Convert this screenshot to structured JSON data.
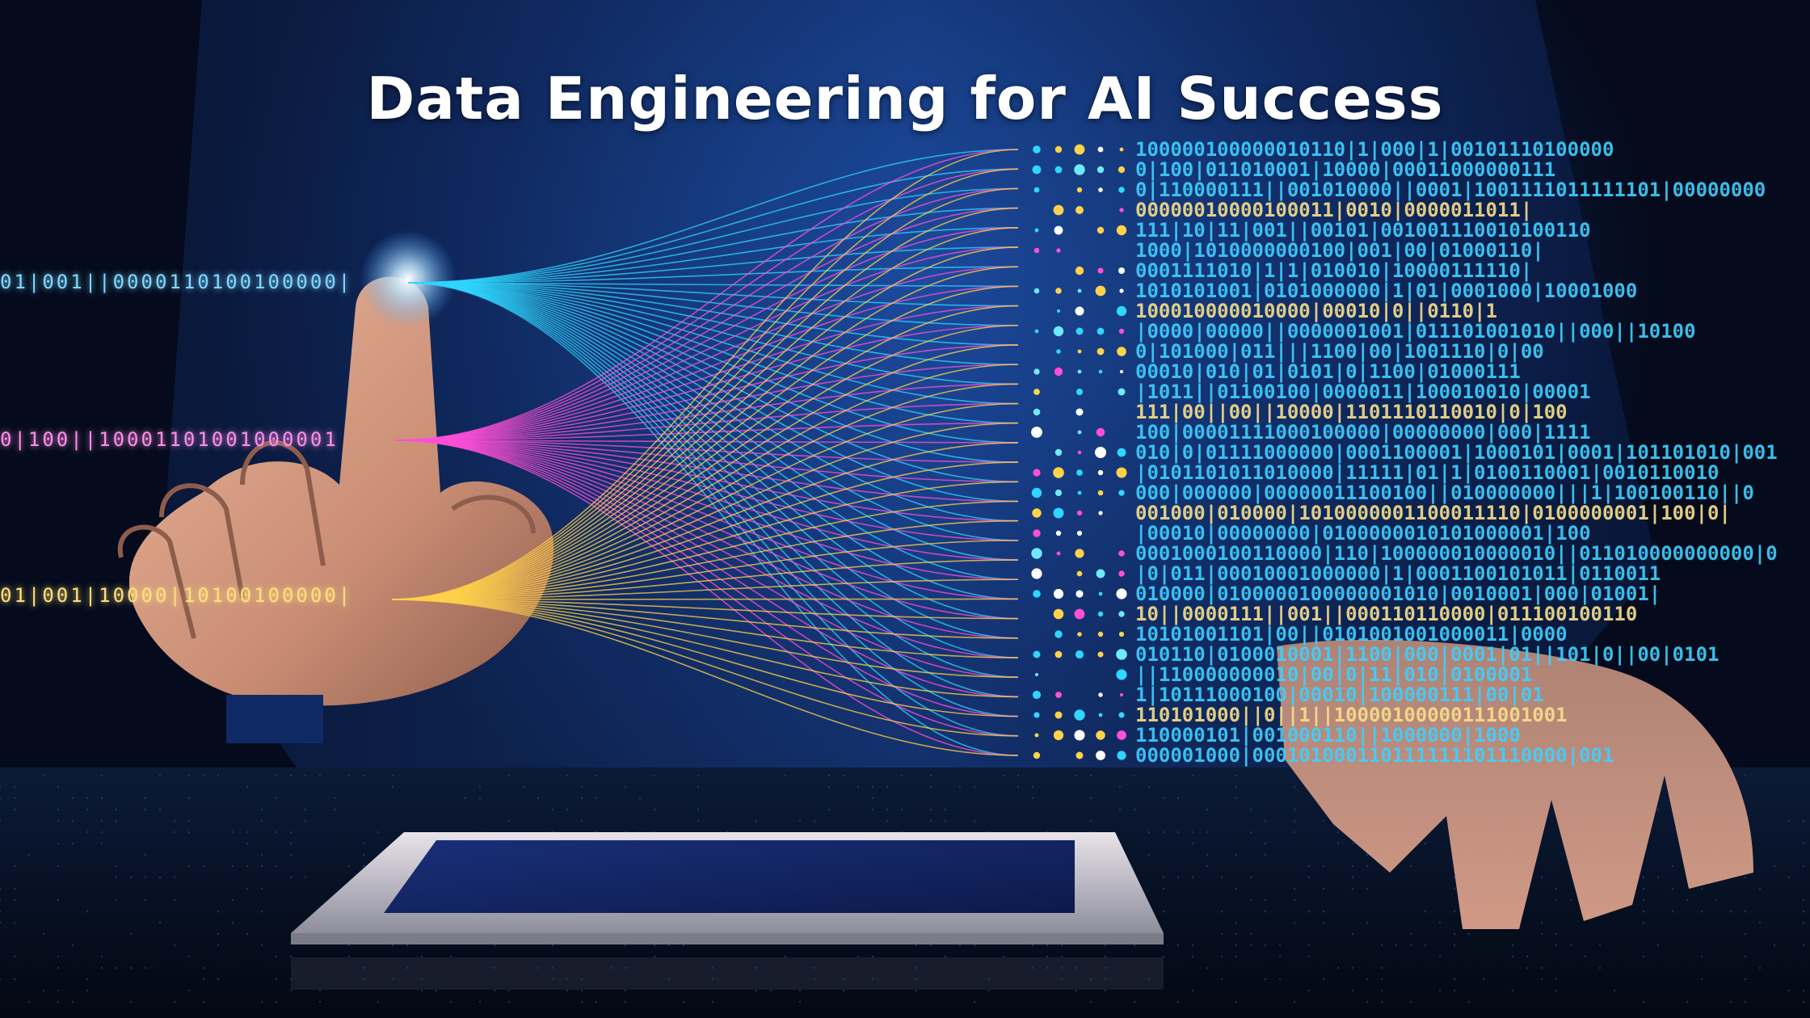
{
  "title": "Data Engineering for AI Success",
  "left_streams": [
    {
      "text": "01|001||0000110100100000|",
      "color": "#7fd8ff"
    },
    {
      "text": "0|100||10001101001000001",
      "color": "#ff8ee8"
    },
    {
      "text": "01|001|10000|10100100000|",
      "color": "#ffe07a"
    }
  ],
  "colors": {
    "cyan": "#2fd6ff",
    "magenta": "#ff4fd8",
    "yellow": "#ffd24a",
    "bg": "#0a1c45"
  },
  "objects": [
    "hand-pointing",
    "fiber-streams",
    "binary-code-wall",
    "tablet",
    "right-hand"
  ]
}
